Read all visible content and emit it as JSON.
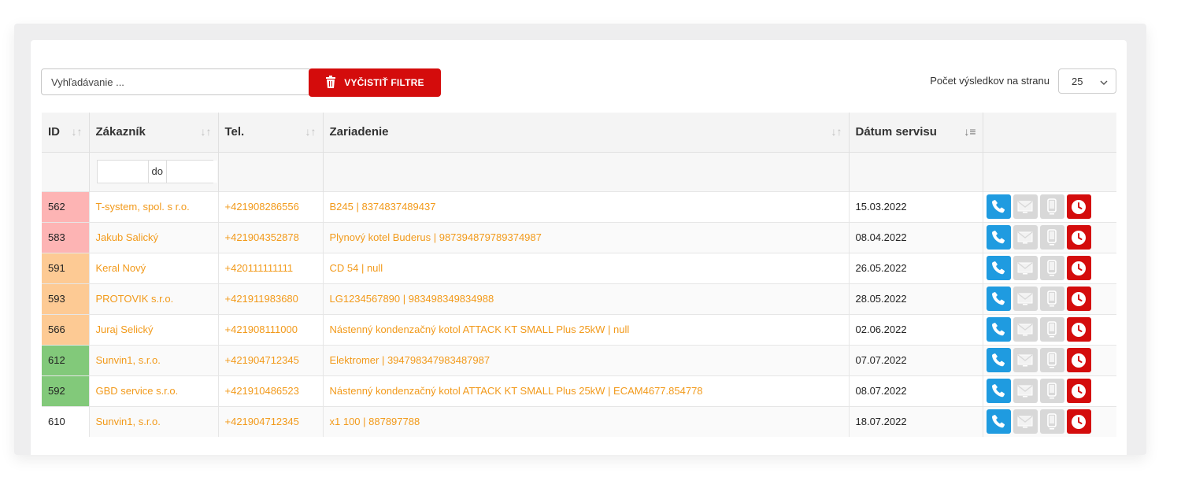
{
  "toolbar": {
    "search_placeholder": "Vyhľadávanie ...",
    "clear_label": "VYČISTIŤ FILTRE",
    "per_page_label": "Počet výsledkov na stranu",
    "per_page_value": "25"
  },
  "table": {
    "headers": [
      "ID",
      "Zákazník",
      "Tel.",
      "Zariadenie",
      "Dátum servisu"
    ],
    "filter_range_label": "do",
    "rows": [
      {
        "id": "562",
        "customer": "T-system, spol. s r.o.",
        "phone": "+421908286556",
        "device": "B245 | 8374837489437",
        "date": "15.03.2022",
        "status": "red"
      },
      {
        "id": "583",
        "customer": "Jakub Salický",
        "phone": "+421904352878",
        "device": "Plynový kotel Buderus | 987394879789374987",
        "date": "08.04.2022",
        "status": "red"
      },
      {
        "id": "591",
        "customer": "Keral Nový",
        "phone": "+420111111111",
        "device": "CD 54 | null",
        "date": "26.05.2022",
        "status": "orange"
      },
      {
        "id": "593",
        "customer": "PROTOVIK s.r.o.",
        "phone": "+421911983680",
        "device": "LG1234567890 | 983498349834988",
        "date": "28.05.2022",
        "status": "orange"
      },
      {
        "id": "566",
        "customer": "Juraj Selický",
        "phone": "+421908111000",
        "device": "Nástenný kondenzačný kotol ATTACK KT SMALL Plus 25kW | null",
        "date": "02.06.2022",
        "status": "orange"
      },
      {
        "id": "612",
        "customer": "Sunvin1, s.r.o.",
        "phone": "+421904712345",
        "device": "Elektromer | 394798347983487987",
        "date": "07.07.2022",
        "status": "green"
      },
      {
        "id": "592",
        "customer": "GBD service s.r.o.",
        "phone": "+421910486523",
        "device": "Nástenný kondenzačný kotol ATTACK KT SMALL Plus 25kW | ECAM4677.854778",
        "date": "08.07.2022",
        "status": "green"
      },
      {
        "id": "610",
        "customer": "Sunvin1, s.r.o.",
        "phone": "+421904712345",
        "device": "x1 100 | 887897788",
        "date": "18.07.2022",
        "status": "none"
      }
    ]
  },
  "status_colors": {
    "red": "#fdb4b4",
    "orange": "#fdca94",
    "green": "#82c97a",
    "none": "transparent"
  },
  "colors": {
    "accent_red": "#d40c0c",
    "link_orange": "#f29a1b",
    "phone_blue": "#1f9be0",
    "disabled_gray": "#d8d8d8"
  },
  "icons": {
    "clear": "trash-icon",
    "per_page": "chevron-down-icon",
    "row_actions": [
      "phone-icon",
      "email-icon",
      "sms-icon",
      "clock-icon"
    ],
    "sort": "sort-icon",
    "sort_active": "sort-descending-icon"
  }
}
